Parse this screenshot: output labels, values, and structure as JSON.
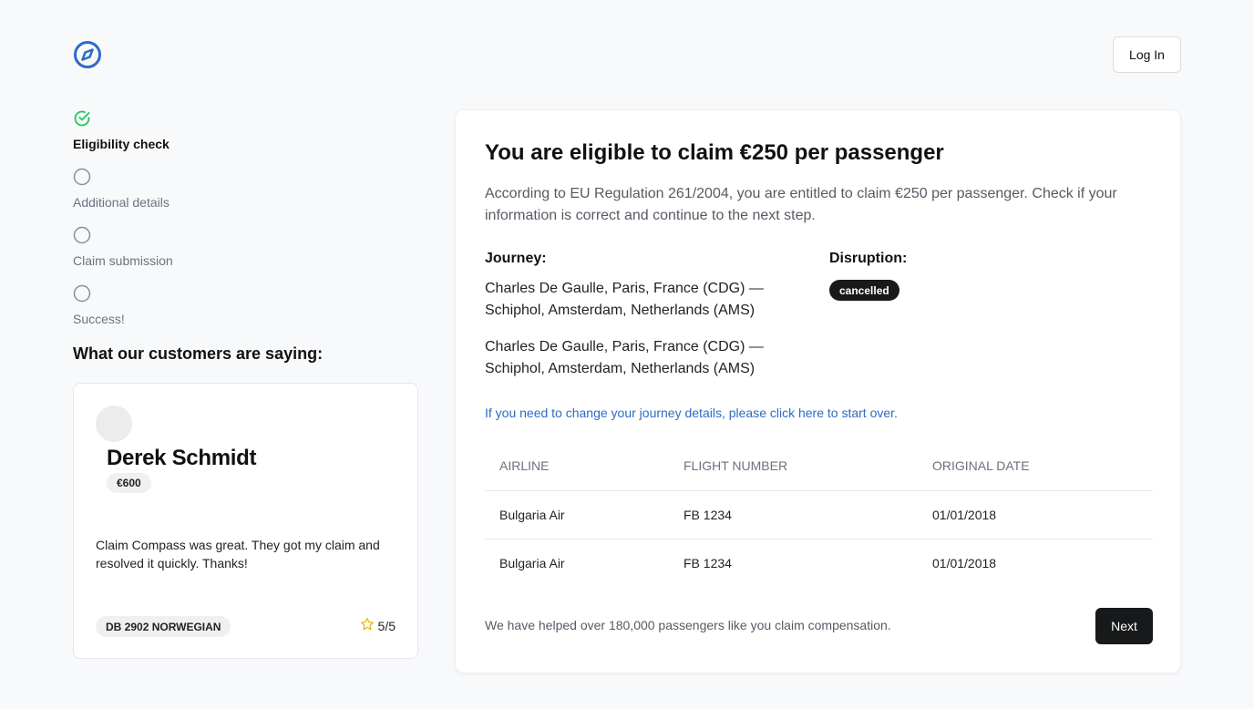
{
  "header": {
    "login_label": "Log In"
  },
  "steps": [
    {
      "label": "Eligibility check",
      "status": "done"
    },
    {
      "label": "Additional details",
      "status": "pending"
    },
    {
      "label": "Claim submission",
      "status": "pending"
    },
    {
      "label": "Success!",
      "status": "pending"
    }
  ],
  "testimonials": {
    "title": "What our customers are saying:",
    "card": {
      "name": "Derek Schmidt",
      "amount": "€600",
      "quote": "Claim Compass was great. They got my claim and resolved it quickly. Thanks!",
      "flight": "DB 2902 NORWEGIAN",
      "rating": "5/5"
    }
  },
  "main": {
    "title": "You are eligible to claim €250 per passenger",
    "description": "According to EU Regulation 261/2004, you are entitled to claim €250 per passenger. Check if your information is correct and continue to the next step.",
    "journey_label": "Journey:",
    "journeys": [
      "Charles De Gaulle, Paris, France (CDG) — Schiphol, Amsterdam, Netherlands (AMS)",
      "Charles De Gaulle, Paris, France (CDG) — Schiphol, Amsterdam, Netherlands (AMS)"
    ],
    "disruption_label": "Disruption:",
    "disruption_value": "cancelled",
    "start_over_link": "If you need to change your journey details, please click here to start over.",
    "table": {
      "headers": [
        "AIRLINE",
        "FLIGHT NUMBER",
        "ORIGINAL DATE"
      ],
      "rows": [
        [
          "Bulgaria Air",
          "FB 1234",
          "01/01/2018"
        ],
        [
          "Bulgaria Air",
          "FB 1234",
          "01/01/2018"
        ]
      ]
    },
    "footer_note": "We have helped over 180,000 passengers like you claim compensation.",
    "next_label": "Next"
  },
  "colors": {
    "brand_blue": "#2d6bc4",
    "success_green": "#22c55e",
    "dark": "#18191b",
    "star_yellow": "#eab308"
  },
  "icons": {
    "logo": "compass-icon",
    "done_step": "check-circle-icon",
    "pending_step": "circle-icon",
    "rating": "star-icon"
  }
}
